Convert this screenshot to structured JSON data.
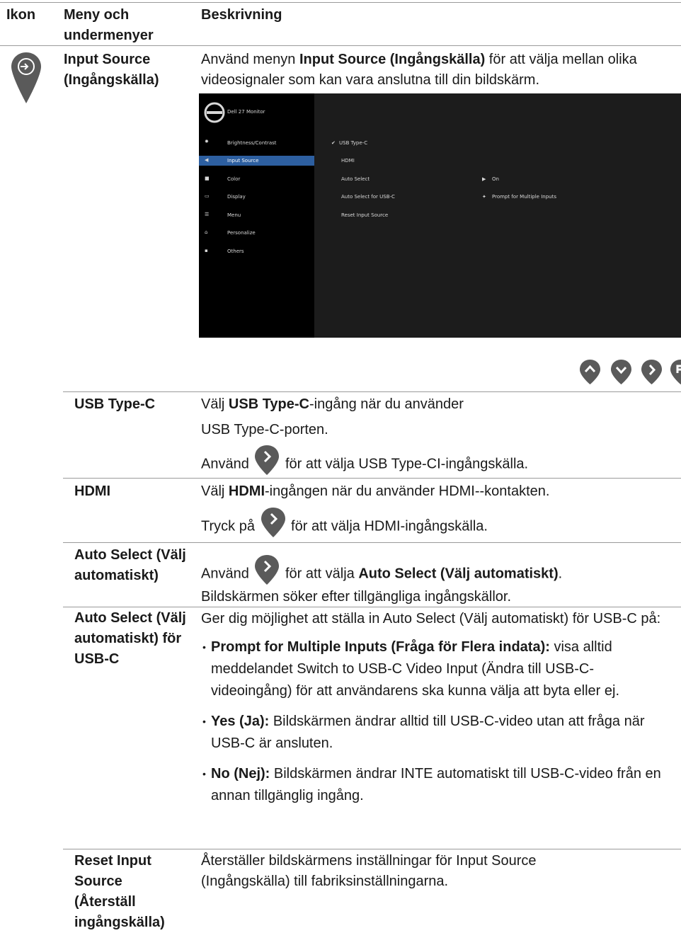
{
  "header": {
    "col_icon": "Ikon",
    "col_menu": "Meny och undermenyer",
    "col_desc": "Beskrivning"
  },
  "main": {
    "title": "Input Source (Ingångskälla)",
    "desc_pre": "Använd menyn ",
    "desc_bold": "Input Source (Ingångskälla)",
    "desc_post": " för att välja mellan olika videosignaler som kan vara anslutna till din bildskärm.",
    "icon": "input-source-icon"
  },
  "osd": {
    "model": "Dell 27 Monitor",
    "menu": [
      "Brightness/Contrast",
      "Input Source",
      "Color",
      "Display",
      "Menu",
      "Personalize",
      "Others"
    ],
    "options": [
      "USB Type-C",
      "HDMI",
      "Auto Select",
      "Auto Select for USB-C",
      "Reset Input Source"
    ],
    "values": {
      "auto_select": "On",
      "auto_select_usbc": "Prompt for Multiple Inputs"
    },
    "nav_icons": [
      "up-icon",
      "down-icon",
      "right-icon",
      "back-icon"
    ]
  },
  "rows": {
    "usbc": {
      "title": "USB Type-C",
      "l1_pre": "Välj ",
      "l1_bold": "USB Type-C",
      "l1_post": "-ingång när du använder",
      "l2": "USB Type-C-porten.",
      "l3_pre": "Använd ",
      "l3_post": " för att välja USB Type-CI-ingångskälla."
    },
    "hdmi": {
      "title": "HDMI",
      "l1_pre": "Välj ",
      "l1_bold": "HDMI",
      "l1_post": "-ingången när du använder HDMI--kontakten.",
      "l2_pre": "Tryck på ",
      "l2_post": " för att välja HDMI-ingångskälla."
    },
    "auto": {
      "title": "Auto Select (Välj automatiskt)",
      "l1_pre": "Använd ",
      "l1_mid": " för att välja ",
      "l1_bold": "Auto Select (Välj automatiskt)",
      "l1_post": ".",
      "l2": "Bildskärmen söker efter tillgängliga ingångskällor."
    },
    "auto_usbc": {
      "title": "Auto Select (Välj automatiskt) för USB-C",
      "intro": "Ger dig möjlighet att ställa in Auto Select (Välj automatiskt) för USB-C på:",
      "b1_bold": "Prompt for Multiple Inputs (Fråga för Flera indata):",
      "b1_text": " visa alltid meddelandet Switch to USB-C Video Input (Ändra till USB-C-videoingång) för att användarens ska kunna välja att byta eller ej.",
      "b2_bold": "Yes (Ja):",
      "b2_text": " Bildskärmen ändrar alltid till USB-C-video utan att fråga när USB-C är ansluten.",
      "b3_bold": "No (Nej):",
      "b3_text": " Bildskärmen ändrar INTE automatiskt till USB-C-video från en annan tillgänglig ingång."
    },
    "reset": {
      "title": "Reset Input Source (Återställ ingångskälla)",
      "desc": "Återställer bildskärmens inställningar för Input Source (Ingångskälla) till fabriksinställningarna."
    }
  },
  "colors": {
    "pin": "#5a5a5a",
    "osd_bg": "#1c1c1c",
    "osd_side": "#000000",
    "osd_highlight": "#2d5fa0"
  }
}
